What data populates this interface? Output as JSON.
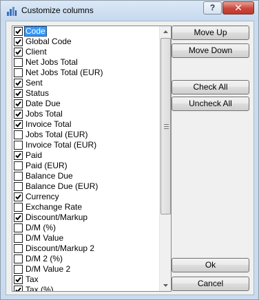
{
  "window": {
    "title": "Customize columns",
    "help_label": "?",
    "close_label": "✕"
  },
  "columns": [
    {
      "label": "Code",
      "checked": true,
      "selected": true
    },
    {
      "label": "Global Code",
      "checked": true
    },
    {
      "label": "Client",
      "checked": true
    },
    {
      "label": "Net Jobs Total",
      "checked": false
    },
    {
      "label": "Net Jobs Total (EUR)",
      "checked": false
    },
    {
      "label": "Sent",
      "checked": true
    },
    {
      "label": "Status",
      "checked": true
    },
    {
      "label": "Date Due",
      "checked": true
    },
    {
      "label": "Jobs Total",
      "checked": true
    },
    {
      "label": "Invoice Total",
      "checked": true
    },
    {
      "label": "Jobs Total (EUR)",
      "checked": false
    },
    {
      "label": "Invoice Total (EUR)",
      "checked": false
    },
    {
      "label": "Paid",
      "checked": true
    },
    {
      "label": "Paid (EUR)",
      "checked": false
    },
    {
      "label": "Balance Due",
      "checked": false
    },
    {
      "label": "Balance Due (EUR)",
      "checked": false
    },
    {
      "label": "Currency",
      "checked": true
    },
    {
      "label": "Exchange Rate",
      "checked": false
    },
    {
      "label": "Discount/Markup",
      "checked": true
    },
    {
      "label": "D/M (%)",
      "checked": false
    },
    {
      "label": "D/M Value",
      "checked": false
    },
    {
      "label": "Discount/Markup 2",
      "checked": false
    },
    {
      "label": "D/M 2 (%)",
      "checked": false
    },
    {
      "label": "D/M Value 2",
      "checked": false
    },
    {
      "label": "Tax",
      "checked": true
    },
    {
      "label": "Tax (%)",
      "checked": true
    }
  ],
  "buttons": {
    "move_up": "Move Up",
    "move_down": "Move Down",
    "check_all": "Check All",
    "uncheck_all": "Uncheck All",
    "ok": "Ok",
    "cancel": "Cancel"
  },
  "icons": {
    "app": "column-chart-icon",
    "help": "help-icon",
    "close": "close-icon",
    "scroll_up": "scroll-up-arrow-icon",
    "scroll_down": "scroll-down-arrow-icon"
  },
  "colors": {
    "selection": "#3399ff",
    "close_button": "#c9473a"
  }
}
